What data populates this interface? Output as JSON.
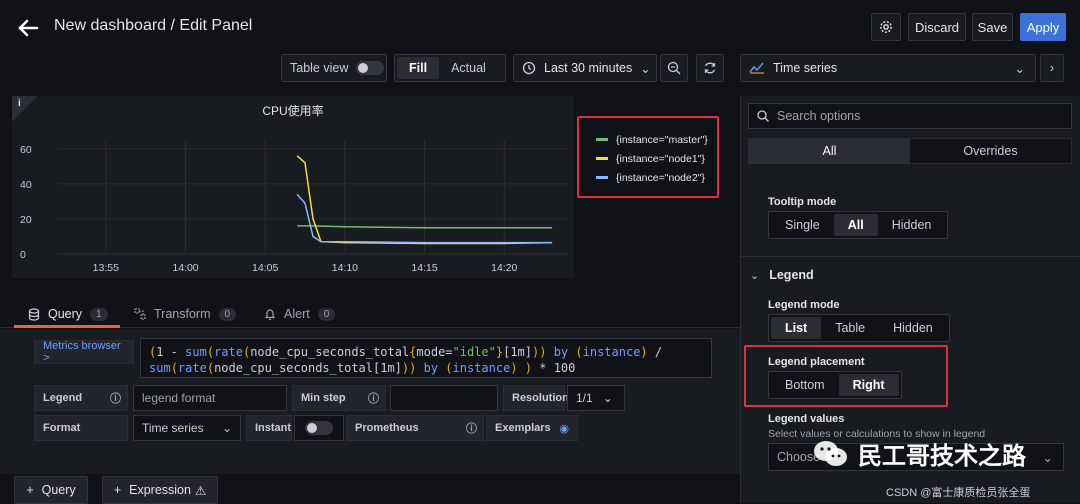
{
  "header": {
    "title": "New dashboard / Edit Panel",
    "discard_label": "Discard",
    "save_label": "Save",
    "apply_label": "Apply"
  },
  "toolbar": {
    "table_view_label": "Table view",
    "fill_label": "Fill",
    "actual_label": "Actual",
    "time_range_label": "Last 30 minutes",
    "visualization_label": "Time series"
  },
  "panel": {
    "info_label": "i"
  },
  "chart_data": {
    "type": "line",
    "title": "CPU使用率",
    "x_ticks": [
      "13:55",
      "14:00",
      "14:05",
      "14:10",
      "14:15",
      "14:20"
    ],
    "y_ticks": [
      "0",
      "20",
      "40",
      "60"
    ],
    "ylim": [
      0,
      65
    ],
    "legend_placement": "right",
    "series": [
      {
        "name": "{instance=\"master\"}",
        "color": "#73bf69",
        "x": [
          "14:07",
          "14:08",
          "14:10",
          "14:15",
          "14:20",
          "14:23"
        ],
        "values": [
          16,
          16,
          15.5,
          15,
          15,
          15
        ]
      },
      {
        "name": "{instance=\"node1\"}",
        "color": "#fade2a",
        "x": [
          "14:07",
          "14:07.5",
          "14:08",
          "14:08.5",
          "14:10",
          "14:15",
          "14:20",
          "14:23"
        ],
        "values": [
          56,
          52,
          20,
          7,
          6.5,
          6,
          6,
          6.5
        ]
      },
      {
        "name": "{instance=\"node2\"}",
        "color": "#8ab8ff",
        "x": [
          "14:07",
          "14:07.5",
          "14:08",
          "14:08.5",
          "14:10",
          "14:15",
          "14:20",
          "14:23"
        ],
        "values": [
          34,
          29,
          10,
          7,
          7,
          6.5,
          6.5,
          6.5
        ]
      }
    ]
  },
  "query_tabs": [
    {
      "label": "Query",
      "count": "1"
    },
    {
      "label": "Transform",
      "count": "0"
    },
    {
      "label": "Alert",
      "count": "0"
    }
  ],
  "query": {
    "metrics_browser_label": "Metrics browser >",
    "legend_label": "Legend",
    "legend_placeholder": "legend format",
    "min_step_label": "Min step",
    "resolution_label": "Resolution",
    "resolution_value": "1/1",
    "format_label": "Format",
    "format_value": "Time series",
    "instant_label": "Instant",
    "prometheus_label": "Prometheus",
    "exemplars_label": "Exemplars"
  },
  "bottom": {
    "add_query_label": "Query",
    "add_expression_label": "Expression"
  },
  "options": {
    "search_placeholder": "Search options",
    "tab_all": "All",
    "tab_overrides": "Overrides",
    "tooltip_mode_label": "Tooltip mode",
    "tooltip_modes": [
      "Single",
      "All",
      "Hidden"
    ],
    "legend_section": "Legend",
    "legend_mode_label": "Legend mode",
    "legend_modes": [
      "List",
      "Table",
      "Hidden"
    ],
    "legend_placement_label": "Legend placement",
    "legend_placements": [
      "Bottom",
      "Right"
    ],
    "legend_values_label": "Legend values",
    "legend_values_desc": "Select values or calculations to show in legend",
    "legend_values_placeholder": "Choose"
  },
  "watermark": {
    "title": "民工哥技术之路",
    "source": "CSDN @富士康质检员张全蛋"
  }
}
